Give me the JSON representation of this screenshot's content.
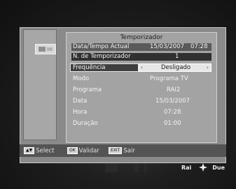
{
  "window": {
    "title": "Temporizador"
  },
  "header": {
    "datetime_label": "Data/Tempo Actual",
    "date_value": "15/03/2007",
    "time_value": "07:28"
  },
  "fields": {
    "timer_no_label": "N. de Temporizador",
    "timer_no_value": "1",
    "frequency_label": "Frequência",
    "frequency_value": "Desligado",
    "mode_label": "Modo",
    "mode_value": "Programa TV",
    "program_label": "Programa",
    "program_value": "RAI2",
    "date_label": "Data",
    "date_value": "15/03/2007",
    "hour_label": "Hora",
    "hour_value": "07:28",
    "duration_label": "Duração",
    "duration_value": "01:00"
  },
  "hints": {
    "select_key": "▲▼",
    "select_label": "Select",
    "ok_key": "OK",
    "ok_label": "Validar",
    "exit_key": "EXIT",
    "exit_label": "Sair"
  },
  "branding": {
    "left": "Rai",
    "right": "Due"
  },
  "icons": {
    "left_arrow": "‹",
    "right_arrow": "›",
    "logo_mark": "logo-mark"
  },
  "colors": {
    "panel": "#8a8a8a",
    "main": "#a3a3a3",
    "highlight": "#303030"
  }
}
